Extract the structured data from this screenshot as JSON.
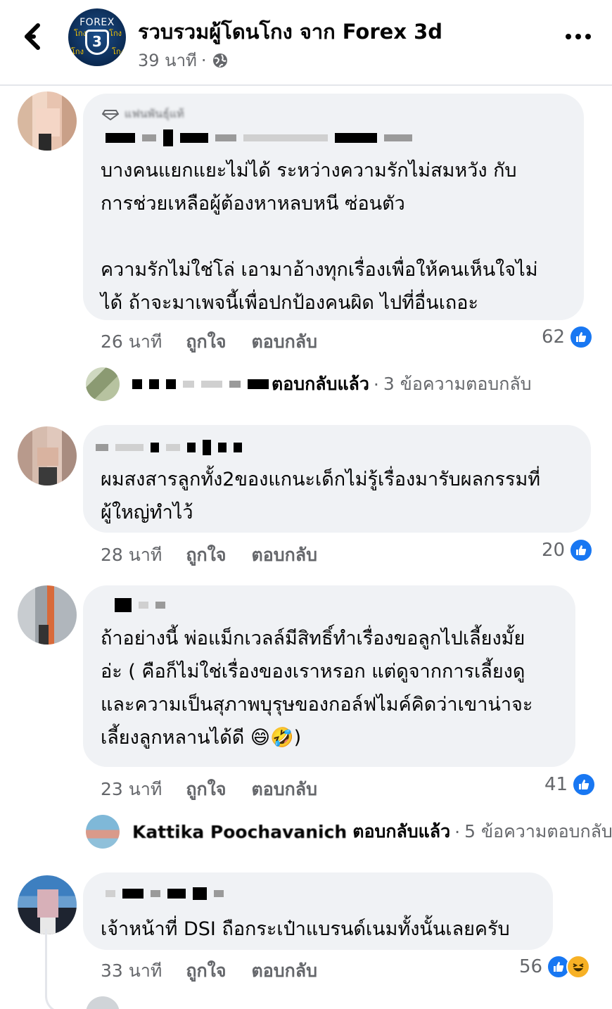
{
  "header": {
    "page_name": "รวบรวมผู้โดนโกง จาก Forex 3d",
    "time": "39 นาที",
    "separator": "·",
    "avatar_text": "FOREX",
    "avatar_tag": "โกง",
    "avatar_number": "3"
  },
  "comments": [
    {
      "top_label": "แฟนพันธุ์แท้",
      "text": "บางคนแยกแยะไม่ได้ ระหว่างความรักไม่สมหวัง กับ\nการช่วยเหลือผู้ต้องหาหลบหนี ซ่อนตัว\n\nความรักไม่ใช่โล่ เอามาอ้างทุกเรื่องเพื่อให้คนเห็นใจไม่\nได้ ถ้าจะมาเพจนี้เพื่อปกป้องคนผิด ไปที่อื่นเถอะ",
      "time": "26 นาที",
      "like_label": "ถูกใจ",
      "reply_label": "ตอบกลับ",
      "reaction_count": "62",
      "replies": {
        "replied_text": "ตอบกลับแล้ว",
        "count_text": "3 ข้อความตอบกลับ"
      }
    },
    {
      "text": "ผมสงสารลูกทั้ง2ของแกนะเด็กไม่รู้เรื่องมารับผลกรรมที่\nผู้ใหญ่ทำไว้",
      "time": "28 นาที",
      "like_label": "ถูกใจ",
      "reply_label": "ตอบกลับ",
      "reaction_count": "20"
    },
    {
      "text": "ถ้าอย่างนี้ พ่อแม็กเวลล์มีสิทธิ์ทำเรื่องขอลูกไปเลี้ยงมั้ย\nอ่ะ ( คือก็ไม่ใช่เรื่องของเราหรอก แต่ดูจากการเลี้ยงดู\nและความเป็นสุภาพบุรุษของกอล์ฟไมค์คิดว่าเขาน่าจะ\nเลี้ยงลูกหลานได้ดี 😄🤣)",
      "time": "23 นาที",
      "like_label": "ถูกใจ",
      "reply_label": "ตอบกลับ",
      "reaction_count": "41",
      "replies": {
        "replier_name": "Kattika Poochavanich",
        "replied_text": "ตอบกลับแล้ว",
        "count_text": "5 ข้อความตอบกลับ"
      }
    },
    {
      "text": "เจ้าหน้าที่ DSI ถือกระเป๋าแบรนด์เนมทั้งนั้นเลยครับ",
      "time": "33 นาที",
      "like_label": "ถูกใจ",
      "reply_label": "ตอบกลับ",
      "reaction_count": "56"
    }
  ],
  "colors": {
    "like_blue": "#1877f2",
    "bubble_bg": "#f0f2f5",
    "meta_gray": "#65676b",
    "haha_yellow": "#f7b125"
  },
  "icons": [
    "back-arrow-icon",
    "globe-icon",
    "more-icon",
    "like-icon",
    "haha-icon"
  ]
}
